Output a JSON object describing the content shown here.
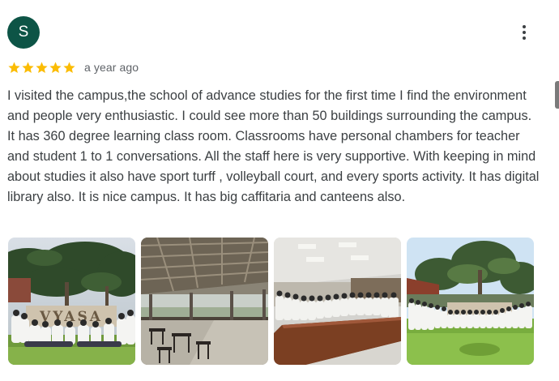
{
  "reviewer": {
    "avatar_letter": "S",
    "avatar_color": "#0d5446"
  },
  "review": {
    "rating": 5,
    "rating_max": 5,
    "star_color": "#fbbc04",
    "time": "a year ago",
    "text": "I visited the campus,the school of advance studies for the first time I find the environment and people very enthusiastic. I could see more than 50 buildings surrounding the campus. It has 360 degree learning class room. Classrooms have personal chambers for teacher and student 1 to 1 conversations. All the staff here is very supportive. With keeping in mind about studies it also have sport turff , volleyball court, and every sports activity. It has digital library also. It is nice campus. It has big caffitaria and canteens also."
  },
  "photos": {
    "count": 4,
    "sign_text": "VYASA"
  },
  "icons": {
    "more": "more-vert-icon",
    "star": "star-icon"
  }
}
